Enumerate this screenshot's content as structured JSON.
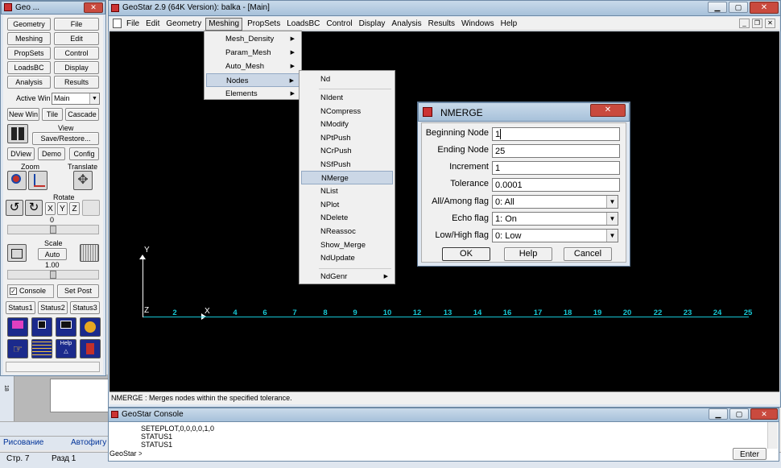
{
  "toolbox": {
    "title": "Geo ...",
    "grid_buttons": [
      "Geometry",
      "File",
      "Meshing",
      "Edit",
      "PropSets",
      "Control",
      "LoadsBC",
      "Display",
      "Analysis",
      "Results"
    ],
    "active_win_label": "Active Win",
    "active_win_value": "Main",
    "win_buttons": [
      "New Win",
      "Tile",
      "Cascade"
    ],
    "view_label": "View",
    "save_restore": "Save/Restore...",
    "misc_buttons": [
      "DView",
      "Demo",
      "Config"
    ],
    "zoom_label": "Zoom",
    "translate_label": "Translate",
    "rotate_label": "Rotate",
    "axis_buttons": [
      "X",
      "Y",
      "Z"
    ],
    "rotate_value": "0",
    "scale_label": "Scale",
    "scale_auto": "Auto",
    "scale_value": "1.00",
    "console_checkbox": "Console",
    "set_post": "Set Post",
    "status_buttons": [
      "Status1",
      "Status2",
      "Status3"
    ]
  },
  "main_window": {
    "title": "GeoStar 2.9 (64K Version): balka - [Main]",
    "menubar": [
      "File",
      "Edit",
      "Geometry",
      "Meshing",
      "PropSets",
      "LoadsBC",
      "Control",
      "Display",
      "Analysis",
      "Results",
      "Windows",
      "Help"
    ],
    "status_text": "NMERGE : Merges nodes within the specified tolerance."
  },
  "meshing_menu": {
    "items": [
      "Mesh_Density",
      "Param_Mesh",
      "Auto_Mesh",
      "Nodes",
      "Elements"
    ],
    "highlighted": "Nodes"
  },
  "nodes_menu": {
    "items": [
      "Nd",
      "NIdent",
      "NCompress",
      "NModify",
      "NPtPush",
      "NCrPush",
      "NSfPush",
      "NMerge",
      "NList",
      "NPlot",
      "NDelete",
      "NReassoc",
      "Show_Merge",
      "NdUpdate",
      "NdGenr"
    ],
    "highlighted": "NMerge"
  },
  "canvas": {
    "y_axis_label": "Y",
    "x_axis_label": "X",
    "z_label": "Z",
    "node_numbers": [
      "2",
      "4",
      "6",
      "7",
      "8",
      "9",
      "10",
      "12",
      "13",
      "14",
      "16",
      "17",
      "18",
      "19",
      "20",
      "22",
      "23",
      "24",
      "25"
    ],
    "line_color": "#16c7d4"
  },
  "dialog": {
    "title": "NMERGE",
    "fields": [
      {
        "label": "Beginning Node",
        "value": "1"
      },
      {
        "label": "Ending Node",
        "value": "25"
      },
      {
        "label": "Increment",
        "value": "1"
      },
      {
        "label": "Tolerance",
        "value": "0.0001"
      }
    ],
    "selects": [
      {
        "label": "All/Among flag",
        "value": "0: All"
      },
      {
        "label": "Echo flag",
        "value": "1: On"
      },
      {
        "label": "Low/High flag",
        "value": "0: Low"
      }
    ],
    "ok": "OK",
    "help": "Help",
    "cancel": "Cancel"
  },
  "console": {
    "title": "GeoStar Console",
    "lines": [
      "SETEPLOT,0,0,0,0,1,0",
      "STATUS1",
      "STATUS1"
    ],
    "prompt": "GeoStar >",
    "enter": "Enter"
  },
  "word_bar": {
    "drawing_menu": "Рисование",
    "autoshapes": "Автофигу",
    "page": "Стр. 7",
    "section": "Разд 1",
    "ruler_mark": "18"
  }
}
